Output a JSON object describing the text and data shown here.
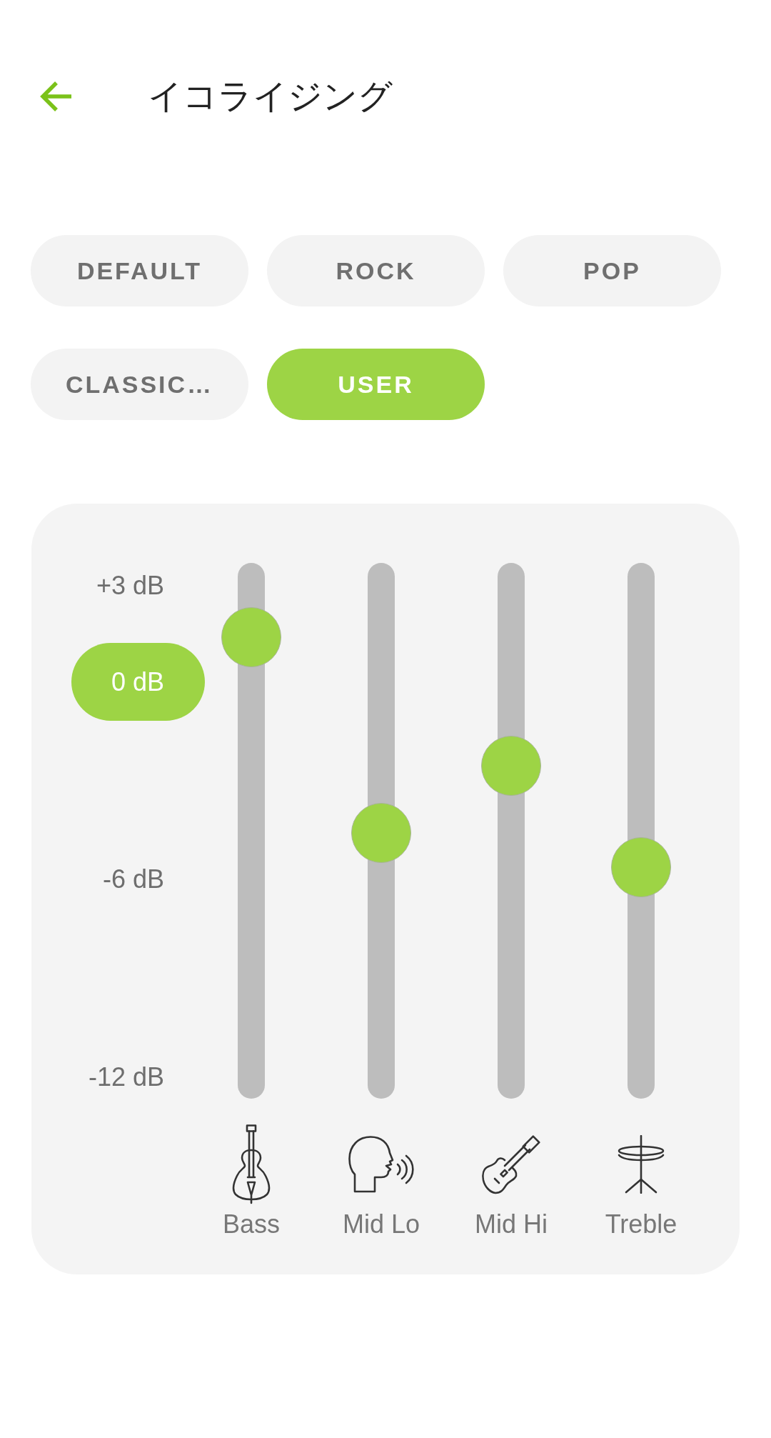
{
  "header": {
    "title": "イコライジング"
  },
  "presets": [
    {
      "label": "DEFAULT",
      "selected": false
    },
    {
      "label": "ROCK",
      "selected": false
    },
    {
      "label": "POP",
      "selected": false
    },
    {
      "label": "CLASSIC…",
      "selected": false
    },
    {
      "label": "USER",
      "selected": true
    }
  ],
  "equalizer": {
    "scale": [
      {
        "label": "+3 dB",
        "selected": false
      },
      {
        "label": "0 dB",
        "selected": true
      },
      {
        "label": "-6 dB",
        "selected": false
      },
      {
        "label": "-12 dB",
        "selected": false
      }
    ],
    "bands": [
      {
        "name": "Bass",
        "level": 0.895
      },
      {
        "name": "Mid Lo",
        "level": 0.497
      },
      {
        "name": "Mid Hi",
        "level": 0.634
      },
      {
        "name": "Treble",
        "level": 0.427
      }
    ]
  }
}
